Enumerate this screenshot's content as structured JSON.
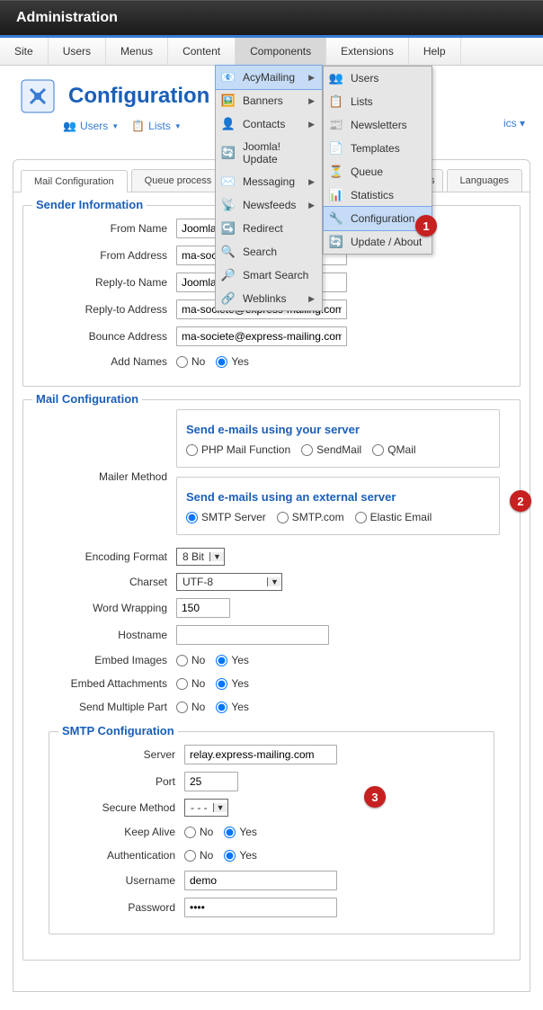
{
  "titlebar": "Administration",
  "menubar": [
    "Site",
    "Users",
    "Menus",
    "Content",
    "Components",
    "Extensions",
    "Help"
  ],
  "components_menu": [
    {
      "label": "AcyMailing",
      "icon": "📧",
      "arrow": true,
      "hilite": true
    },
    {
      "label": "Banners",
      "icon": "🖼️",
      "arrow": true
    },
    {
      "label": "Contacts",
      "icon": "👤",
      "arrow": true
    },
    {
      "label": "Joomla! Update",
      "icon": "🔄",
      "arrow": false
    },
    {
      "label": "Messaging",
      "icon": "✉️",
      "arrow": true
    },
    {
      "label": "Newsfeeds",
      "icon": "📡",
      "arrow": true
    },
    {
      "label": "Redirect",
      "icon": "↪️",
      "arrow": false
    },
    {
      "label": "Search",
      "icon": "🔍",
      "arrow": false
    },
    {
      "label": "Smart Search",
      "icon": "🔎",
      "arrow": false
    },
    {
      "label": "Weblinks",
      "icon": "🔗",
      "arrow": true
    }
  ],
  "acy_submenu": [
    {
      "label": "Users",
      "icon": "👥"
    },
    {
      "label": "Lists",
      "icon": "📋"
    },
    {
      "label": "Newsletters",
      "icon": "📰"
    },
    {
      "label": "Templates",
      "icon": "📄"
    },
    {
      "label": "Queue",
      "icon": "⏳"
    },
    {
      "label": "Statistics",
      "icon": "📊"
    },
    {
      "label": "Configuration",
      "icon": "🔧",
      "hilite": true
    },
    {
      "label": "Update / About",
      "icon": "🔄"
    }
  ],
  "page_title": "Configuration",
  "subactions": {
    "users": "Users",
    "lists": "Lists"
  },
  "partial_nav": "ics ▾",
  "tabs": {
    "mail": "Mail Configuration",
    "queue": "Queue process",
    "plugins": "gins",
    "lang": "Languages"
  },
  "sender": {
    "legend": "Sender Information",
    "from_name_label": "From Name",
    "from_name": "Joomla",
    "from_addr_label": "From Address",
    "from_addr": "ma-soc",
    "reply_name_label": "Reply-to Name",
    "reply_name": "Joomla Express-Mailing",
    "reply_addr_label": "Reply-to Address",
    "reply_addr": "ma-societe@express-mailing.com",
    "bounce_label": "Bounce Address",
    "bounce": "ma-societe@express-mailing.com",
    "add_names_label": "Add Names",
    "no": "No",
    "yes": "Yes"
  },
  "mail": {
    "legend": "Mail Configuration",
    "mailer_label": "Mailer Method",
    "srvhead": "Send e-mails using your server",
    "php": "PHP Mail Function",
    "sendmail": "SendMail",
    "qmail": "QMail",
    "exthead": "Send e-mails using an external server",
    "smtp_server": "SMTP Server",
    "smtpcom": "SMTP.com",
    "elastic": "Elastic Email",
    "encfmt_label": "Encoding Format",
    "encfmt": "8 Bit",
    "charset_label": "Charset",
    "charset": "UTF-8",
    "wrap_label": "Word Wrapping",
    "wrap": "150",
    "host_label": "Hostname",
    "host": "",
    "embedimg_label": "Embed Images",
    "embedatt_label": "Embed Attachments",
    "multi_label": "Send Multiple Part",
    "no": "No",
    "yes": "Yes"
  },
  "smtp": {
    "legend": "SMTP Configuration",
    "server_label": "Server",
    "server": "relay.express-mailing.com",
    "port_label": "Port",
    "port": "25",
    "secure_label": "Secure Method",
    "secure": "- - -",
    "keep_label": "Keep Alive",
    "auth_label": "Authentication",
    "user_label": "Username",
    "user": "demo",
    "pass_label": "Password",
    "pass": "••••",
    "no": "No",
    "yes": "Yes"
  },
  "callouts": {
    "c1": "1",
    "c2": "2",
    "c3": "3"
  }
}
